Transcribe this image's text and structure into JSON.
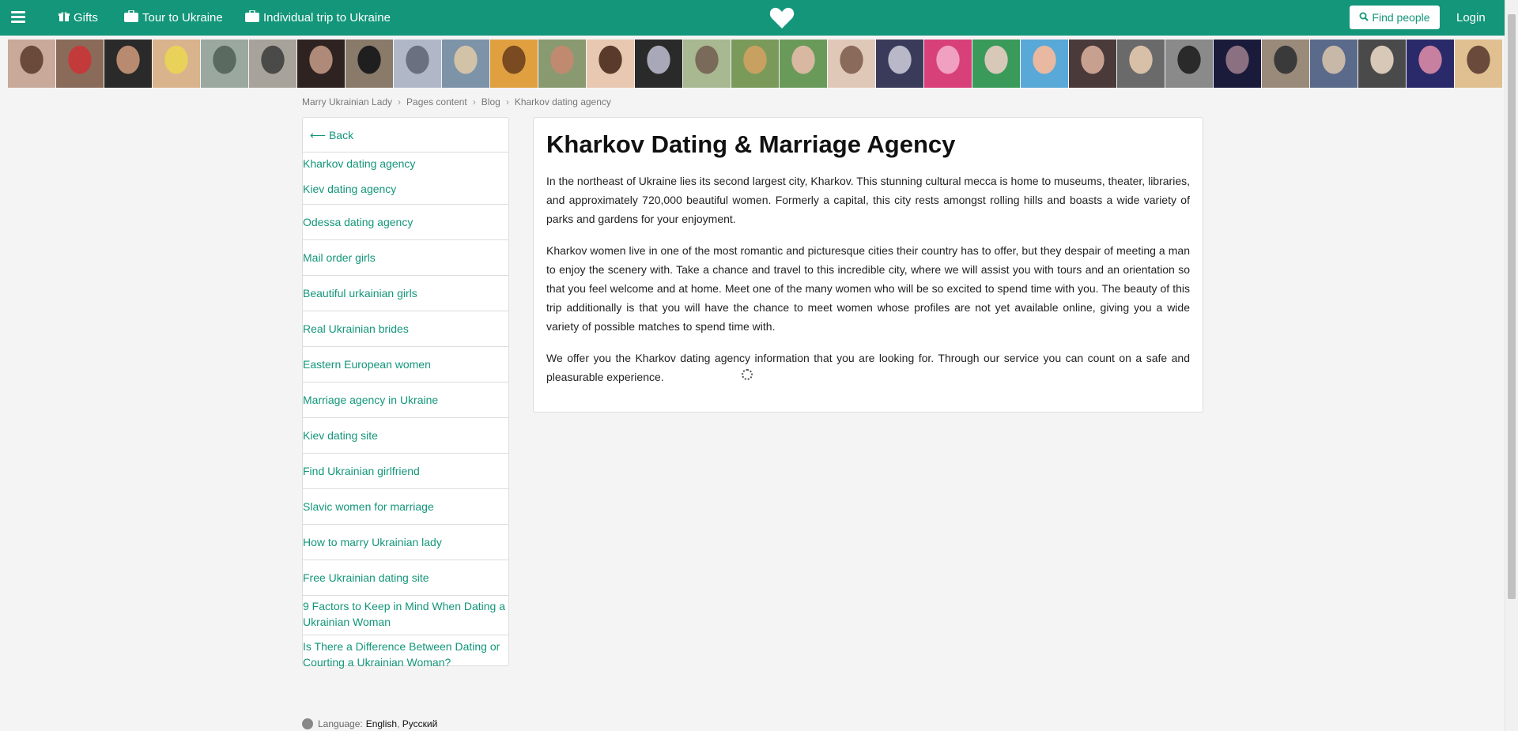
{
  "header": {
    "gifts_label": "Gifts",
    "tour_label": "Tour to Ukraine",
    "trip_label": "Individual trip to Ukraine",
    "find_label": "Find people",
    "login_label": "Login",
    "brand_color": "#13967a",
    "icons": [
      "hamburger-icon",
      "gift-icon",
      "suitcase-icon",
      "heart-icon",
      "search-icon"
    ]
  },
  "photos": {
    "count": 31
  },
  "breadcrumb": [
    "Marry Ukrainian Lady",
    "Pages content",
    "Blog",
    "Kharkov dating agency"
  ],
  "sidebar": {
    "back_label": "⟵ Back",
    "items": [
      "Kharkov dating agency",
      "Kiev dating agency",
      "Odessa dating agency",
      "Mail order girls",
      "Beautiful urkainian girls",
      "Real Ukrainian brides",
      "Eastern European women",
      "Marriage agency in Ukraine",
      "Kiev dating site",
      "Find Ukrainian girlfriend",
      "Slavic women for marriage",
      "How to marry Ukrainian lady",
      "Free Ukrainian dating site",
      "9 Factors to Keep in Mind When Dating a Ukrainian Woman",
      "Is There a Difference Between Dating or Courting a Ukrainian Woman?"
    ]
  },
  "article": {
    "title": "Kharkov Dating & Marriage Agency",
    "paragraphs": [
      "In the northeast of Ukraine lies its second largest city, Kharkov. This stunning cultural mecca is home to museums, theater, libraries, and approximately 720,000 beautiful women. Formerly a capital, this city rests amongst rolling hills and boasts a wide variety of parks and gardens for your enjoyment.",
      "Kharkov women live in one of the most romantic and picturesque cities their country has to offer, but they despair of meeting a man to enjoy the scenery with. Take a chance and travel to this incredible city, where we will assist you with tours and an orientation so that you feel welcome and at home. Meet one of the many women who will be so excited to spend time with you. The beauty of this trip additionally is that you will have the chance to meet women whose profiles are not yet available online, giving you a wide variety of possible matches to spend time with.",
      "We offer you the Kharkov dating agency information that you are looking for. Through our service you can count on a safe and pleasurable experience."
    ]
  },
  "footer": {
    "language_label": "Language:",
    "lang_english": "English",
    "lang_russian": "Русский"
  }
}
